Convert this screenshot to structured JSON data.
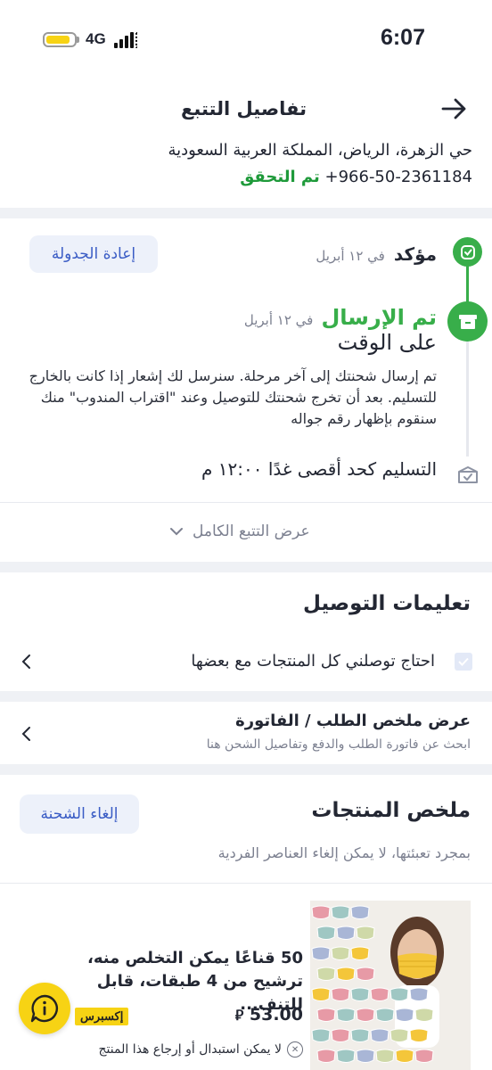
{
  "status_bar": {
    "network": "4G",
    "time": "6:07",
    "battery_level": 0.75
  },
  "header": {
    "title": "تفاصيل التتبع"
  },
  "address": {
    "line": "حي الزهرة، الرياض، المملكة العربية السعودية",
    "phone": "+966-50-2361184",
    "verified": "تم التحقق"
  },
  "tracking": {
    "confirmed_status": "مؤكد",
    "confirmed_date": "في ١٢ أبريل",
    "reschedule_label": "إعادة الجدولة",
    "shipped_status": "تم الإرسال",
    "shipped_date": "في ١٢ أبريل",
    "on_time": "على الوقت",
    "message": "تم إرسال شحنتك إلى آخر مرحلة. سنرسل لك إشعار إذا كانت بالخارج للتسليم. بعد أن تخرج شحنتك للتوصيل وعند \"اقتراب المندوب\" منك سنقوم بإظهار رقم جواله",
    "delivery_by": "التسليم كحد أقصى غدًا ١٢:٠٠ م",
    "view_full_label": "عرض التتبع الكامل"
  },
  "delivery_instructions": {
    "title": "تعليمات التوصيل",
    "checkbox_label": "احتاج توصلني كل المنتجات مع بعضها"
  },
  "order_summary": {
    "title": "عرض ملخص الطلب / الفاتورة",
    "subtitle": "ابحث عن فاتورة الطلب والدفع وتفاصيل الشحن هنا"
  },
  "product_summary": {
    "title": "ملخص المنتجات",
    "cancel_label": "إلغاء الشحنة",
    "note": "بمجرد تعبئتها، لا يمكن إلغاء العناصر الفردية",
    "product": {
      "name": "50 قناعًا يمكن التخلص منه، ترشيح من 4 طبقات، قابل للتنف...",
      "price": "53.00",
      "express_badge": "إكسبرس",
      "return_note": "لا يمكن استبدال أو إرجاع هذا المنتج"
    }
  },
  "colors": {
    "accent_green": "#38ae4a",
    "accent_blue": "#3a5cc5",
    "brand_yellow": "#f7d314"
  }
}
